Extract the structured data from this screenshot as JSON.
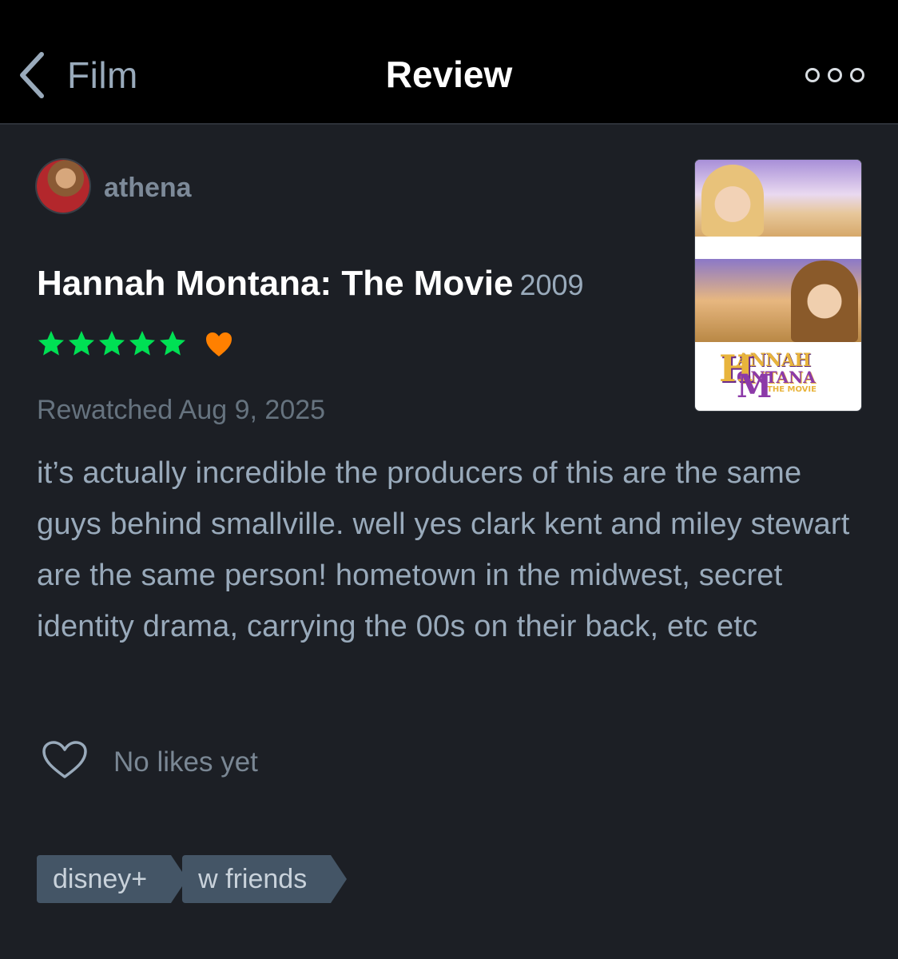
{
  "header": {
    "back_label": "Film",
    "title": "Review",
    "more_icon": "more-dots-icon"
  },
  "review": {
    "author": "athena",
    "film_title": "Hannah Montana: The Movie",
    "year": "2009",
    "rating_stars": 5,
    "liked": true,
    "watched_line": "Rewatched Aug 9, 2025",
    "text": "it’s actually incredible the producers of this are the same guys behind smallville. well yes clark kent and miley stewart are the same person! hometown in the midwest, secret identity drama, carrying the 00s on their back, etc etc",
    "likes_label": "No likes yet",
    "tags": [
      "disney+",
      "w friends"
    ]
  },
  "poster": {
    "logo_line1": "ANNAH",
    "logo_line2": "ONTANA",
    "logo_line3": "THE MOVIE",
    "logo_big_h": "H",
    "logo_big_m": "M"
  },
  "colors": {
    "background": "#1c1f25",
    "header_bg": "#000000",
    "star_green": "#00e054",
    "heart_orange": "#ff8000",
    "tag_bg": "#445566",
    "muted_text": "#99aabb"
  }
}
